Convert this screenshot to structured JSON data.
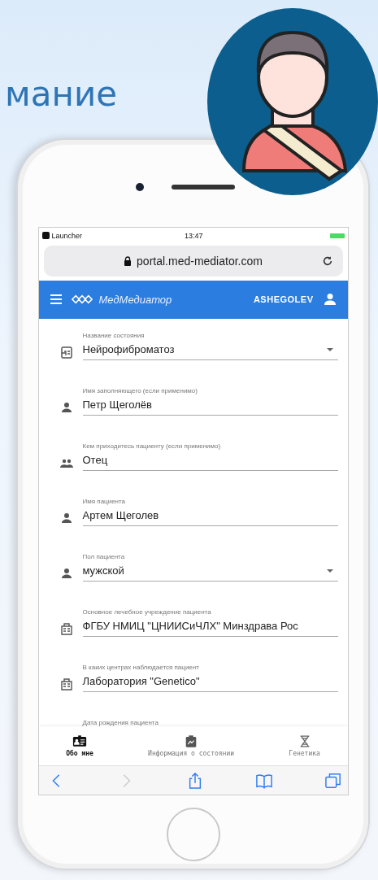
{
  "slide_title": "мание",
  "status_bar": {
    "app": "Launcher",
    "time": "13:47"
  },
  "address_bar": {
    "url": "portal.med-mediator.com"
  },
  "app_bar": {
    "brand": "МедМедиатор",
    "user": "ASHEGOLEV"
  },
  "fields": [
    {
      "label": "Название состояния",
      "value": "Нейрофиброматоз",
      "kind": "select"
    },
    {
      "label": "Имя заполняющего (если применимо)",
      "value": "Петр Щеголёв",
      "kind": "text"
    },
    {
      "label": "Кем приходитесь пациенту (если применимо)",
      "value": "Отец",
      "kind": "text"
    },
    {
      "label": "Имя пациента",
      "value": "Артем Щеголев",
      "kind": "text"
    },
    {
      "label": "Пол пациента",
      "value": "мужской",
      "kind": "select"
    },
    {
      "label": "Основное лечебное учреждение пациента",
      "value": "ФГБУ НМИЦ \"ЦНИИСиЧЛХ\" Минздрава Рос",
      "kind": "text"
    },
    {
      "label": "В каких центрах наблюдается пациент",
      "value": "Лаборатория \"Genetico\"",
      "kind": "text"
    }
  ],
  "next_field_label": "Дата рождения пациента",
  "bottom_nav": [
    {
      "label": "Обо мне",
      "selected": true
    },
    {
      "label": "Информация о состоянии",
      "selected": false
    },
    {
      "label": "Генетика",
      "selected": false
    }
  ],
  "toolbar": [
    {
      "disabled": false
    },
    {
      "disabled": true
    },
    {
      "disabled": false
    },
    {
      "disabled": false
    },
    {
      "disabled": false
    }
  ]
}
